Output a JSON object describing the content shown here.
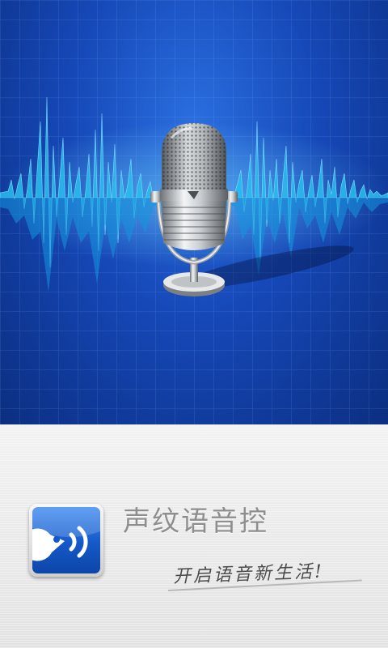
{
  "splash": {
    "app_name": "声纹语音控",
    "slogan": "开启语音新生活!",
    "hero_image": "microphone-on-soundwave",
    "app_icon": "voice-face-icon"
  },
  "colors": {
    "hero_blue": "#1648b8",
    "wave_cyan": "#1ec8f0",
    "panel_gray": "#e8e8e8",
    "title_gray": "#8e8e8e"
  }
}
